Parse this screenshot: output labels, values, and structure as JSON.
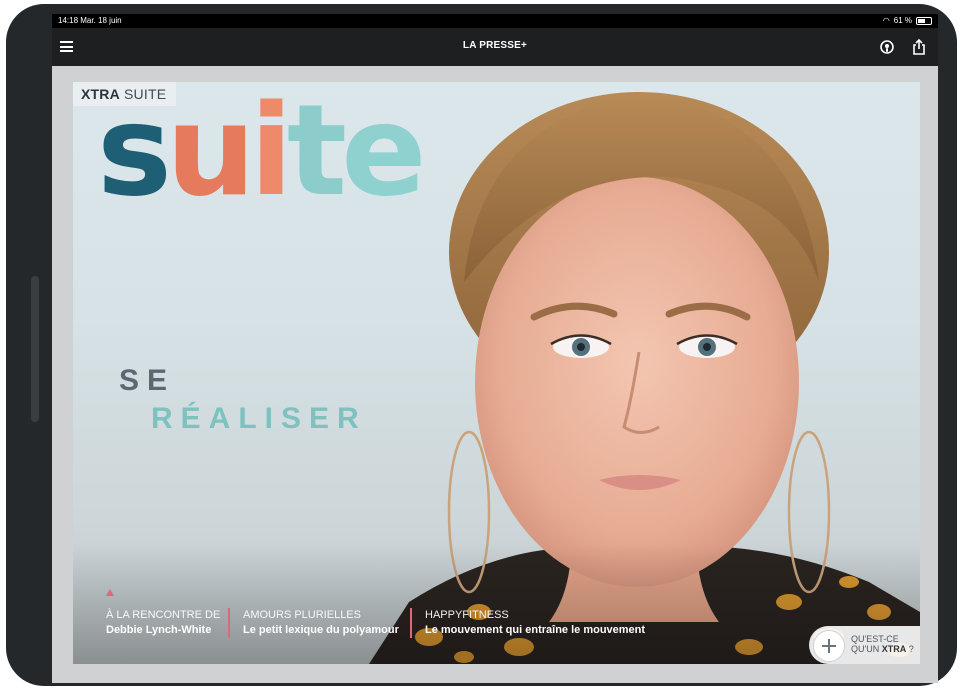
{
  "status_bar": {
    "time": "14:18",
    "date": "Mar. 18 juin",
    "battery": "61 %"
  },
  "navbar": {
    "brand": "LA PRESSE+",
    "icons": [
      "menu-icon",
      "podcast-icon",
      "share-icon"
    ]
  },
  "cover": {
    "section_bold": "XTRA",
    "section_rest": "SUITE",
    "title_letters": [
      "s",
      "u",
      "i",
      "t",
      "e"
    ],
    "headline_line1": "SE",
    "headline_line2": "RÉALISER",
    "teasers": [
      {
        "kicker": "À LA RENCONTRE DE",
        "title": "Debbie Lynch-White"
      },
      {
        "kicker": "AMOURS PLURIELLES",
        "title": "Le petit lexique du polyamour"
      },
      {
        "kicker": "HAPPYFITNESS",
        "title": "Le mouvement qui entraîne le mouvement"
      }
    ],
    "xtra_button": {
      "line1": "QU'EST-CE",
      "line2_prefix": "QU'UN",
      "line2_bold": "XTRA",
      "line2_suffix": " ?"
    }
  },
  "colors": {
    "device": "#25282b",
    "navbar": "#1e1f21",
    "accent_pink": "#e0667b",
    "title_teal_dark": "#1f5f76",
    "title_coral": "#e57b5c",
    "title_mint": "#8ccdcb",
    "headline_gray": "#5c6772",
    "headline_mint": "#7ec2bf"
  }
}
